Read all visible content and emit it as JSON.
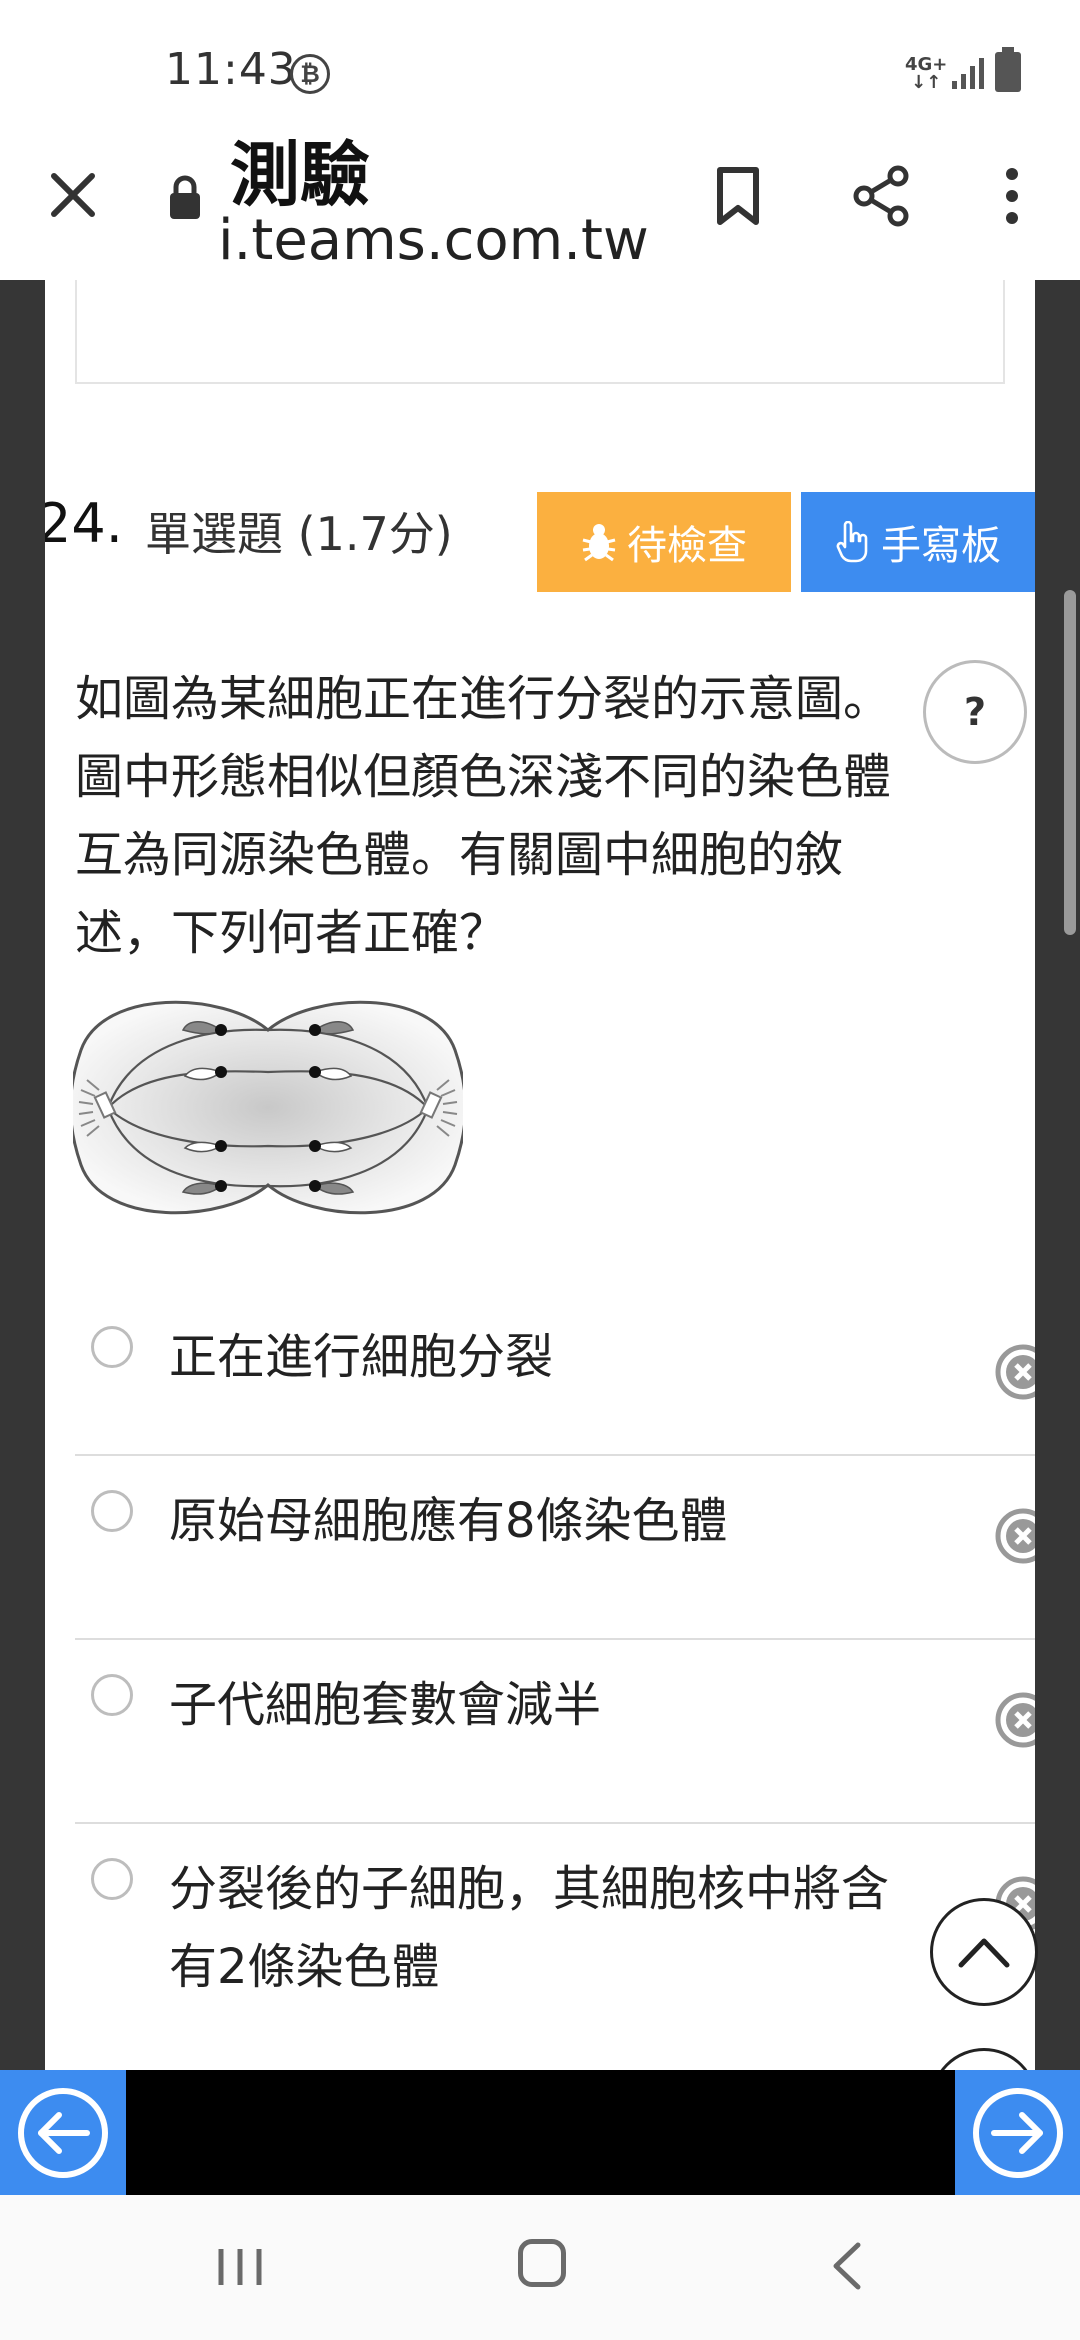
{
  "status_bar": {
    "time": "11:43",
    "coin_glyph": "₿",
    "network": "4G+",
    "network_arrows": "↓↑"
  },
  "toolbar": {
    "page_name": "測驗",
    "url": "i.teams.com.tw"
  },
  "question": {
    "number": "24.",
    "type": "單選題 (1.7分)",
    "pending_label": "待檢查",
    "draw_label": "手寫板",
    "help_label": "?",
    "text": "如圖為某細胞正在進行分裂的示意圖。圖中形態相似但顏色深淺不同的染色體互為同源染色體。有關圖中細胞的敘述，下列何者正確？"
  },
  "options": [
    {
      "text": "正在進行細胞分裂"
    },
    {
      "text": "原始母細胞應有8條染色體"
    },
    {
      "text": "子代細胞套數會減半"
    },
    {
      "text": "分裂後的子細胞，其細胞核中將含有2條染色體"
    }
  ],
  "colors": {
    "pending": "#fbb040",
    "draw": "#3d8cf0",
    "nav": "#3d8cf0",
    "page_bg": "#363636"
  },
  "icons": {
    "close": "close-icon",
    "lock": "lock-icon",
    "bookmark": "bookmark-icon",
    "share": "share-icon",
    "more": "more-vertical-icon",
    "pending": "bug-icon",
    "draw": "hand-pointer-icon",
    "clear": "clear-circle-icon",
    "scroll_top": "chevron-up-icon",
    "prev": "arrow-left-circle-icon",
    "next": "arrow-right-circle-icon"
  }
}
